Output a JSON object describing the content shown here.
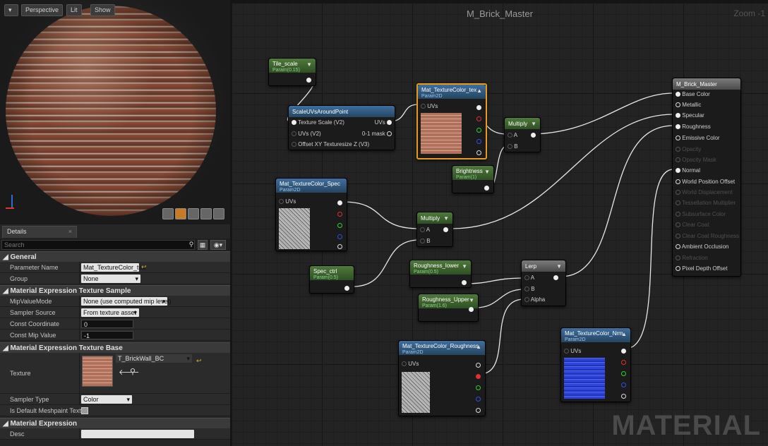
{
  "viewport": {
    "perspective_label": "Perspective",
    "lit_label": "Lit",
    "show_label": "Show"
  },
  "details": {
    "tab_label": "Details",
    "search_placeholder": "Search",
    "categories": {
      "general": "General",
      "texture_sample": "Material Expression Texture Sample",
      "texture_base": "Material Expression Texture Base",
      "material_expression": "Material Expression"
    },
    "rows": {
      "parameter_name": {
        "label": "Parameter Name",
        "value": "Mat_TextureColor_tex"
      },
      "group": {
        "label": "Group",
        "value": "None"
      },
      "mip_value_mode": {
        "label": "MipValueMode",
        "value": "None (use computed mip level)"
      },
      "sampler_source": {
        "label": "Sampler Source",
        "value": "From texture asset"
      },
      "const_coordinate": {
        "label": "Const Coordinate",
        "value": "0"
      },
      "const_mip_value": {
        "label": "Const Mip Value",
        "value": "-1"
      },
      "texture": {
        "label": "Texture",
        "value": "T_BrickWall_BC"
      },
      "sampler_type": {
        "label": "Sampler Type",
        "value": "Color"
      },
      "is_default_meshpaint": {
        "label": "Is Default Meshpaint Textur"
      },
      "desc": {
        "label": "Desc",
        "value": ""
      }
    }
  },
  "graph": {
    "title": "M_Brick_Master",
    "zoom_label": "Zoom -1",
    "watermark": "MATERIAL",
    "nodes": {
      "tile_scale": {
        "title": "Tile_scale",
        "sub": "Param(0.15)"
      },
      "scale_uvs": {
        "title": "ScaleUVsAroundPoint",
        "pins": [
          "Texture Scale (V2)",
          "UVs (V2)",
          "Offset XY Texturesize Z (V3)"
        ],
        "outputs": [
          "UVs",
          "0-1 mask"
        ]
      },
      "tex_color": {
        "title": "Mat_TextureColor_tex",
        "sub": "Param2D",
        "uvs": "UVs"
      },
      "multiply1": {
        "title": "Multiply",
        "a": "A",
        "b": "B"
      },
      "brightness": {
        "title": "Brightness",
        "sub": "Param(1)"
      },
      "tex_spec": {
        "title": "Mat_TextureColor_Spec",
        "sub": "Param2D",
        "uvs": "UVs"
      },
      "multiply2": {
        "title": "Multiply",
        "a": "A",
        "b": "B"
      },
      "spec_ctrl": {
        "title": "Spec_ctrl",
        "sub": "Param(0.5)"
      },
      "rough_lower": {
        "title": "Roughness_lower",
        "sub": "Param(0.5)"
      },
      "rough_upper": {
        "title": "Roughness_Upper",
        "sub": "Param(1.6)"
      },
      "lerp": {
        "title": "Lerp",
        "a": "A",
        "b": "B",
        "alpha": "Alpha"
      },
      "tex_rough": {
        "title": "Mat_TextureColor_Roughness",
        "sub": "Param2D",
        "uvs": "UVs"
      },
      "tex_nrm": {
        "title": "Mat_TextureColor_Nrm",
        "sub": "Param2D",
        "uvs": "UVs"
      },
      "result": {
        "title": "M_Brick_Master",
        "inputs": [
          "Base Color",
          "Metallic",
          "Specular",
          "Roughness",
          "Emissive Color",
          "Opacity",
          "Opacity Mask",
          "Normal",
          "World Position Offset",
          "World Displacement",
          "Tessellation Multiplier",
          "Subsurface Color",
          "Clear Coat",
          "Clear Coat Roughness",
          "Ambient Occlusion",
          "Refraction",
          "Pixel Depth Offset"
        ]
      }
    }
  }
}
